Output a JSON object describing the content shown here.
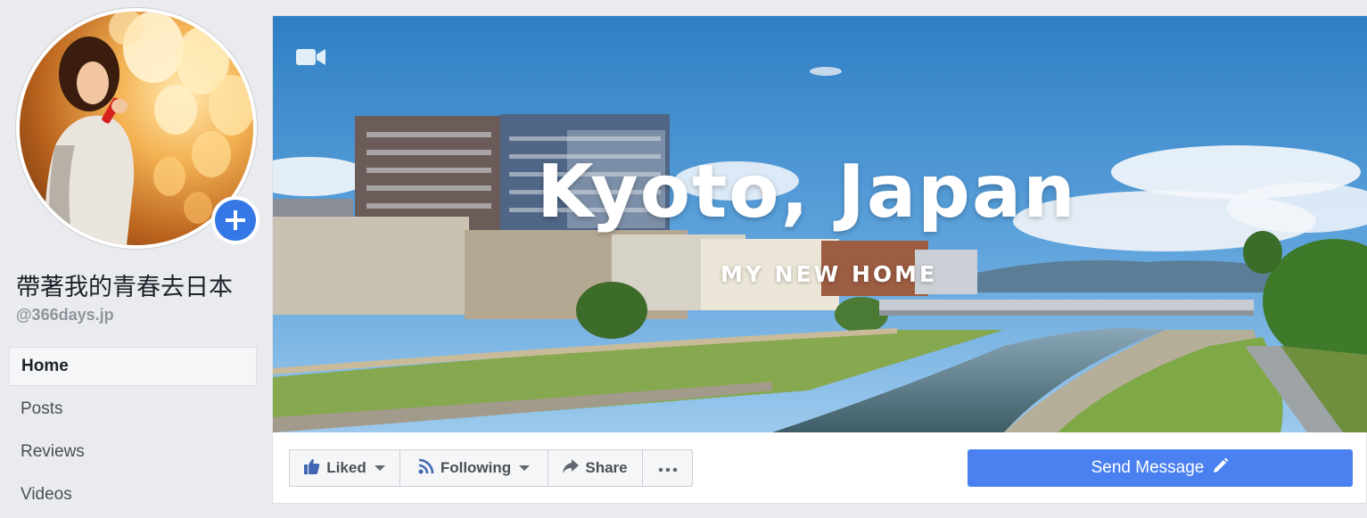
{
  "page": {
    "name": "帶著我的青春去日本",
    "handle": "@366days.jp"
  },
  "nav": {
    "items": [
      {
        "label": "Home",
        "active": true
      },
      {
        "label": "Posts",
        "active": false
      },
      {
        "label": "Reviews",
        "active": false
      },
      {
        "label": "Videos",
        "active": false
      }
    ]
  },
  "cover": {
    "title": "Kyoto, Japan",
    "subtitle": "MY NEW HOME",
    "video_icon": "video-camera-icon"
  },
  "actions": {
    "liked_label": "Liked",
    "following_label": "Following",
    "share_label": "Share",
    "more_icon": "ellipsis-icon",
    "send_message_label": "Send Message"
  },
  "colors": {
    "page_bg": "#e9ebee",
    "accent_blue": "#4a80f0",
    "add_photo_blue": "#3578e5",
    "text_dark": "#1d2129",
    "text_grey": "#90949c"
  }
}
